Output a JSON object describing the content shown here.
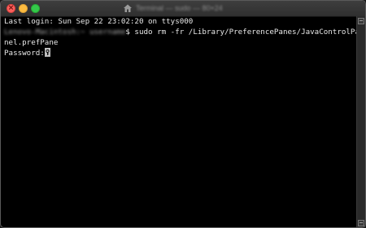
{
  "window": {
    "title": "Terminal — sudo — 80×24"
  },
  "terminal": {
    "last_login": "Last login: Sun Sep 22 23:02:20 on ttys000",
    "prompt_host": "Lenovo-Macintosh:~ username",
    "command": "$ sudo rm -fr /Library/PreferencePanes/JavaControlPa",
    "command_wrap": "nel.prefPane",
    "password_prompt": "Password:"
  },
  "icons": {
    "close": "close-icon",
    "minimize": "minimize-icon",
    "zoom": "zoom-icon",
    "home": "home-folder-icon",
    "cursor": "key-cursor-icon"
  },
  "colors": {
    "close": "#fc605c",
    "minimize": "#fdbc40",
    "zoom": "#34c84a",
    "background": "#000000",
    "text": "#e8e8e8"
  }
}
